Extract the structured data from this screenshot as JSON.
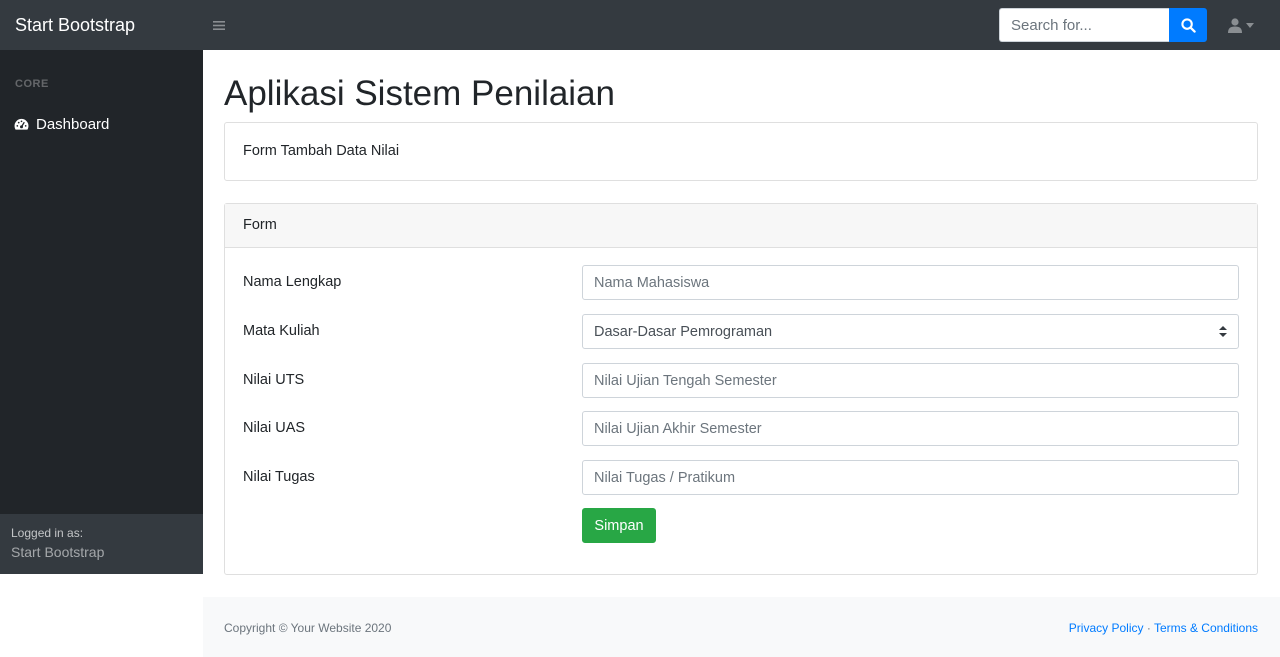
{
  "navbar": {
    "brand": "Start Bootstrap",
    "search_placeholder": "Search for...",
    "toggle_icon": "menu-icon",
    "search_icon": "search-icon",
    "user_icon": "user-icon"
  },
  "sidebar": {
    "heading": "CORE",
    "items": [
      {
        "label": "Dashboard",
        "icon": "dashboard-icon"
      }
    ],
    "footer": {
      "logged_in_label": "Logged in as:",
      "user_name": "Start Bootstrap"
    }
  },
  "main": {
    "title": "Aplikasi Sistem Penilaian",
    "subtitle_card": "Form Tambah Data Nilai",
    "form_card": {
      "header": "Form",
      "fields": [
        {
          "label": "Nama Lengkap",
          "placeholder": "Nama Mahasiswa"
        },
        {
          "label": "Mata Kuliah",
          "selected": "Dasar-Dasar Pemrograman"
        },
        {
          "label": "Nilai UTS",
          "placeholder": "Nilai Ujian Tengah Semester"
        },
        {
          "label": "Nilai UAS",
          "placeholder": "Nilai Ujian Akhir Semester"
        },
        {
          "label": "Nilai Tugas",
          "placeholder": "Nilai Tugas / Pratikum"
        }
      ],
      "submit_label": "Simpan"
    }
  },
  "footer": {
    "copyright": "Copyright © Your Website 2020",
    "privacy": "Privacy Policy",
    "separator": "·",
    "terms": "Terms & Conditions"
  },
  "colors": {
    "navbar_bg": "#343a40",
    "sidebar_bg": "#212529",
    "primary": "#007bff",
    "success": "#28a745"
  }
}
